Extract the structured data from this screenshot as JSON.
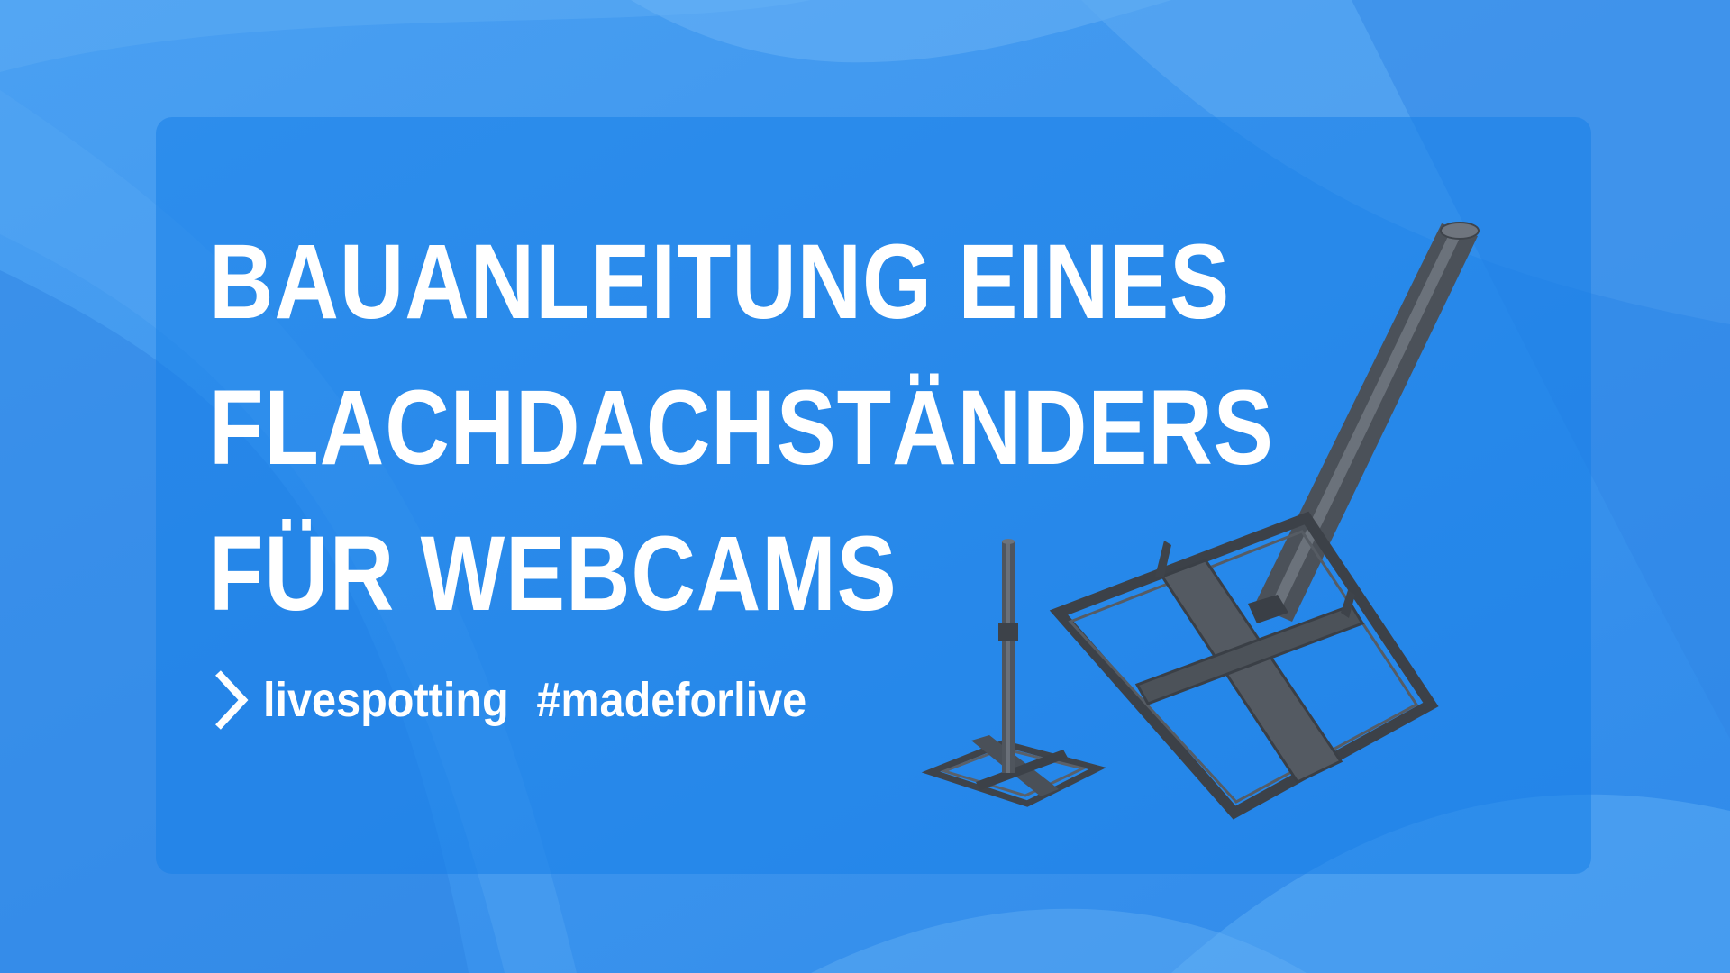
{
  "headline": {
    "line1": "BAUANLEITUNG EINES",
    "line2": "FLACHDACHSTÄNDERS",
    "line3": "FÜR WEBCAMS"
  },
  "brand": {
    "name": "livespotting",
    "hashtag": "#madeforlive",
    "icon": "chevron-right-icon"
  },
  "colors": {
    "background": "#3d96ee",
    "panel": "#1e88e5",
    "text": "#ffffff",
    "steel": "#4a4f57"
  }
}
